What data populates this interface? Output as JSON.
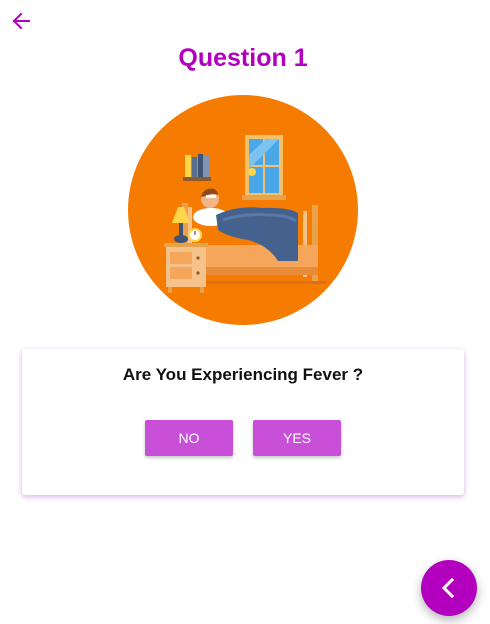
{
  "header": {
    "title": "Question 1",
    "back_icon": "arrow-left-icon"
  },
  "illustration": {
    "icon": "sick-in-bed-illustration"
  },
  "card": {
    "question": "Are You Experiencing Fever ?",
    "no_label": "NO",
    "yes_label": "YES"
  },
  "fab": {
    "icon": "chevron-left-icon"
  },
  "colors": {
    "accent": "#b300bf",
    "button": "#c84fd8",
    "illustration_bg": "#f57c00"
  }
}
